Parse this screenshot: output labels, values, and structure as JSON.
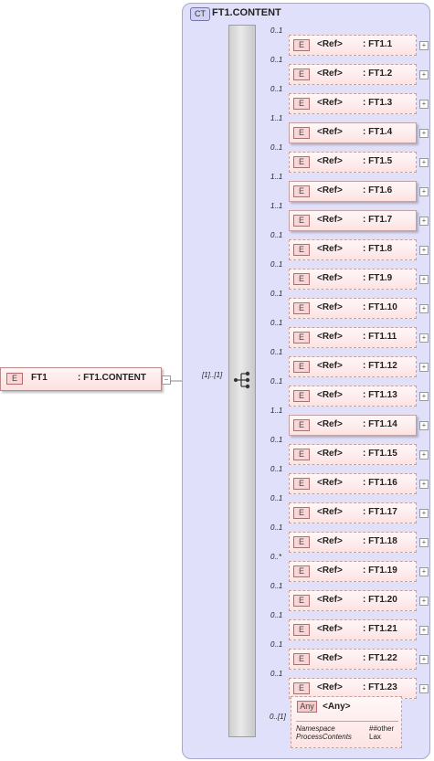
{
  "complex_type": {
    "badge": "CT",
    "title": "FT1.CONTENT"
  },
  "root_element": {
    "badge": "E",
    "name": "FT1",
    "type": ": FT1.CONTENT",
    "cardinality": "[1]..[1]"
  },
  "sequence_icon": "sequence-compositor-icon",
  "refs": [
    {
      "card": "0..1",
      "label": "<Ref>",
      "type": ": FT1.1",
      "optional": true
    },
    {
      "card": "0..1",
      "label": "<Ref>",
      "type": ": FT1.2",
      "optional": true
    },
    {
      "card": "0..1",
      "label": "<Ref>",
      "type": ": FT1.3",
      "optional": true
    },
    {
      "card": "1..1",
      "label": "<Ref>",
      "type": ": FT1.4",
      "optional": false
    },
    {
      "card": "0..1",
      "label": "<Ref>",
      "type": ": FT1.5",
      "optional": true
    },
    {
      "card": "1..1",
      "label": "<Ref>",
      "type": ": FT1.6",
      "optional": false
    },
    {
      "card": "1..1",
      "label": "<Ref>",
      "type": ": FT1.7",
      "optional": false
    },
    {
      "card": "0..1",
      "label": "<Ref>",
      "type": ": FT1.8",
      "optional": true
    },
    {
      "card": "0..1",
      "label": "<Ref>",
      "type": ": FT1.9",
      "optional": true
    },
    {
      "card": "0..1",
      "label": "<Ref>",
      "type": ": FT1.10",
      "optional": true
    },
    {
      "card": "0..1",
      "label": "<Ref>",
      "type": ": FT1.11",
      "optional": true
    },
    {
      "card": "0..1",
      "label": "<Ref>",
      "type": ": FT1.12",
      "optional": true
    },
    {
      "card": "0..1",
      "label": "<Ref>",
      "type": ": FT1.13",
      "optional": true
    },
    {
      "card": "1..1",
      "label": "<Ref>",
      "type": ": FT1.14",
      "optional": false
    },
    {
      "card": "0..1",
      "label": "<Ref>",
      "type": ": FT1.15",
      "optional": true
    },
    {
      "card": "0..1",
      "label": "<Ref>",
      "type": ": FT1.16",
      "optional": true
    },
    {
      "card": "0..1",
      "label": "<Ref>",
      "type": ": FT1.17",
      "optional": true
    },
    {
      "card": "0..1",
      "label": "<Ref>",
      "type": ": FT1.18",
      "optional": true
    },
    {
      "card": "0..*",
      "label": "<Ref>",
      "type": ": FT1.19",
      "optional": true
    },
    {
      "card": "0..1",
      "label": "<Ref>",
      "type": ": FT1.20",
      "optional": true
    },
    {
      "card": "0..1",
      "label": "<Ref>",
      "type": ": FT1.21",
      "optional": true
    },
    {
      "card": "0..1",
      "label": "<Ref>",
      "type": ": FT1.22",
      "optional": true
    },
    {
      "card": "0..1",
      "label": "<Ref>",
      "type": ": FT1.23",
      "optional": true
    }
  ],
  "any": {
    "card": "0..[1]",
    "badge": "Any",
    "title": "<Any>",
    "attributes": [
      {
        "name": "Namespace",
        "value": "##other"
      },
      {
        "name": "ProcessContents",
        "value": "Lax"
      }
    ]
  },
  "colors": {
    "panel": "#e0e0fb",
    "element_fill": "#fde3e3",
    "element_border": "#c4a0a0"
  }
}
